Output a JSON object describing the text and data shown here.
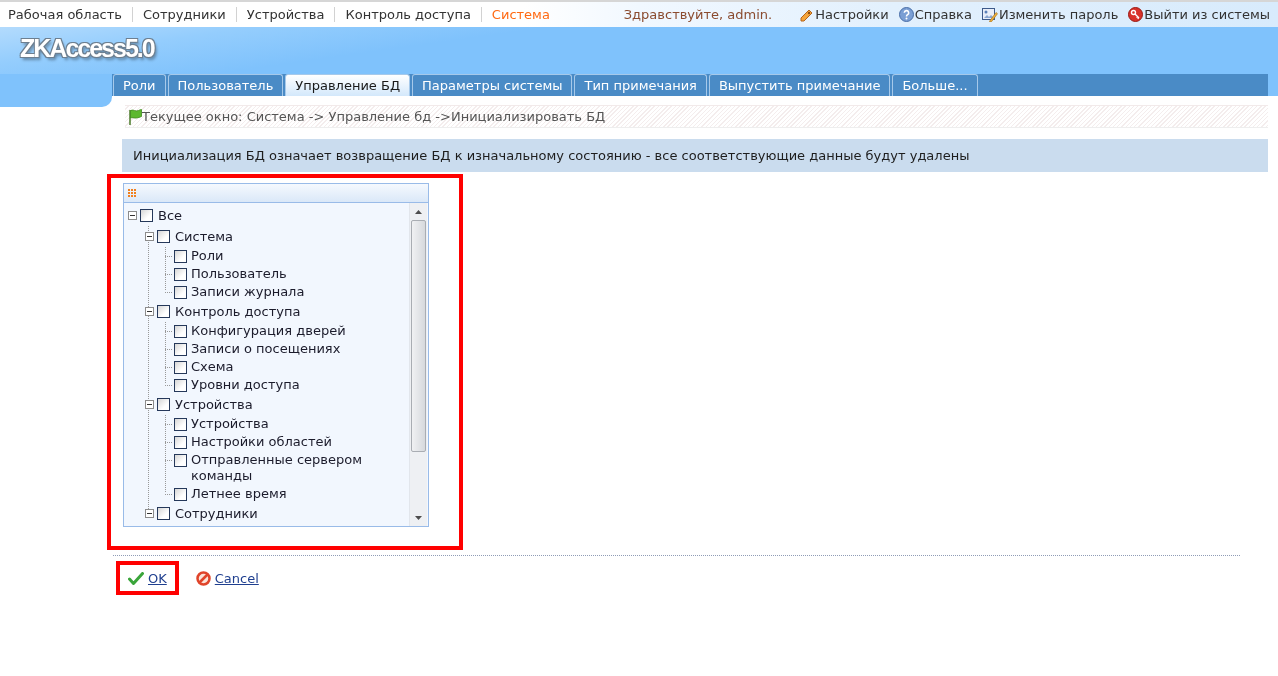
{
  "top_nav": {
    "items": [
      {
        "label": "Рабочая область",
        "selected": false
      },
      {
        "label": "Сотрудники",
        "selected": false
      },
      {
        "label": "Устройства",
        "selected": false
      },
      {
        "label": "Контроль доступа",
        "selected": false
      },
      {
        "label": "Система",
        "selected": true
      }
    ]
  },
  "user_bar": {
    "greeting": "Здравствуйте, admin.",
    "links": [
      {
        "label": "Настройки",
        "kind": "settings"
      },
      {
        "label": "Справка",
        "kind": "help"
      },
      {
        "label": "Изменить пароль",
        "kind": "password"
      },
      {
        "label": "Выйти из системы",
        "kind": "logout"
      }
    ]
  },
  "header": {
    "logo": "ZKAccess5.0"
  },
  "tabs": [
    {
      "label": "Роли",
      "selected": false
    },
    {
      "label": "Пользователь",
      "selected": false
    },
    {
      "label": "Управление БД",
      "selected": true
    },
    {
      "label": "Параметры системы",
      "selected": false
    },
    {
      "label": "Тип примечания",
      "selected": false
    },
    {
      "label": "Выпустить примечание",
      "selected": false
    },
    {
      "label": "Больше...",
      "selected": false
    }
  ],
  "breadcrumb": {
    "text": "Текущее окно: Система -> Управление бд ->Инициализировать БД"
  },
  "notice": {
    "text": "Инициализация БД означает возвращение БД к изначальному состоянию - все соответствующие данные будут удалены"
  },
  "tree": {
    "highlighted": true,
    "nodes": [
      {
        "label": "Все",
        "checked": false,
        "expanded": true,
        "children": [
          {
            "label": "Система",
            "checked": false,
            "expanded": true,
            "children": [
              {
                "label": "Роли",
                "checked": false
              },
              {
                "label": "Пользователь",
                "checked": false
              },
              {
                "label": "Записи журнала",
                "checked": false
              }
            ]
          },
          {
            "label": "Контроль доступа",
            "checked": false,
            "expanded": true,
            "children": [
              {
                "label": "Конфигурация дверей",
                "checked": false
              },
              {
                "label": "Записи о посещениях",
                "checked": false
              },
              {
                "label": "Схема",
                "checked": false
              },
              {
                "label": "Уровни доступа",
                "checked": false
              }
            ]
          },
          {
            "label": "Устройства",
            "checked": false,
            "expanded": true,
            "children": [
              {
                "label": "Устройства",
                "checked": false
              },
              {
                "label": "Настройки областей",
                "checked": false
              },
              {
                "label": "Отправленные сервером команды",
                "checked": false
              },
              {
                "label": "Летнее время",
                "checked": false
              }
            ]
          },
          {
            "label": "Сотрудники",
            "checked": false,
            "expanded": true
          }
        ]
      }
    ]
  },
  "actions": [
    {
      "label": "OK",
      "kind": "ok",
      "highlighted": true
    },
    {
      "label": "Cancel",
      "kind": "cancel",
      "highlighted": false
    }
  ]
}
